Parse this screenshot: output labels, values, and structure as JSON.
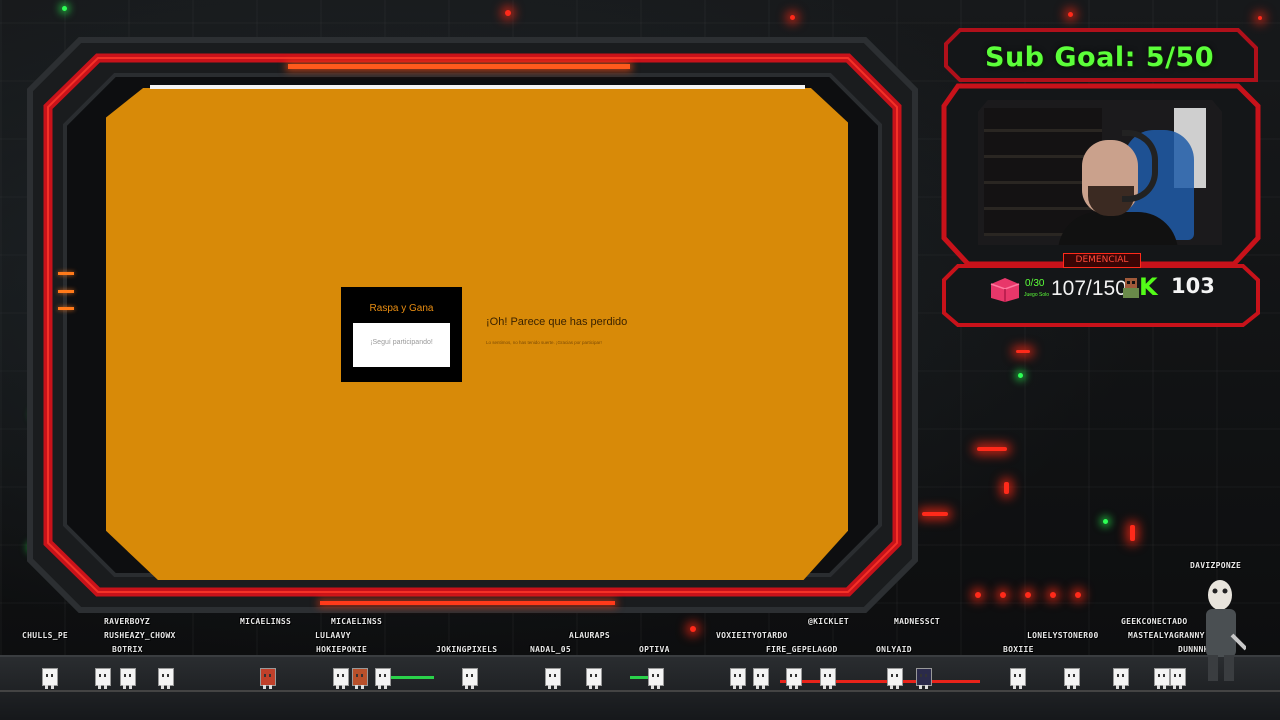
{
  "scratch_game": {
    "card_title": "Raspa y Gana",
    "card_result": "¡Seguí participando!",
    "heading": "¡Oh! Parece que has perdido",
    "subtext": "Lo sentimos, no has tenido suerte. ¡Gracias por participar!"
  },
  "overlay": {
    "sub_goal": "Sub Goal: 5/50",
    "cam_caption": "DEMENCIAL",
    "box_count": "0/30",
    "box_label": "Juego Solo",
    "progress_count": "107/150",
    "kick_count": "103",
    "kick_letter": "K"
  },
  "chat_users": {
    "row1": [
      "RAVERBOYZ",
      "MICAELINSS",
      "MICAELINSS",
      "@KICKLET",
      "MADNESSCT",
      "GEEKCONECTADO",
      "DAVIZPONZE"
    ],
    "row2": [
      "CHULLS_PE",
      "RUSHEAZY_CHOWX",
      "LULAAVY",
      "ALAURAPS",
      "VOXIEITYOTARDO",
      "LONELYSTONER00",
      "MASTEALYAGRANNY"
    ],
    "row3": [
      "BOTRIX",
      "HOKIEPOKIE",
      "JOKINGPIXELS",
      "NADAL_05",
      "OPTIVA",
      "FIRE_GEPELAGOD",
      "ONLYAID",
      "BOXIIE",
      "DUNNNHZCL"
    ]
  },
  "colors": {
    "screen": "#d88a08",
    "frame_accent": "#ff2a1a",
    "sub_goal_text": "#5cff3a",
    "kick_brand": "#53fc18"
  }
}
